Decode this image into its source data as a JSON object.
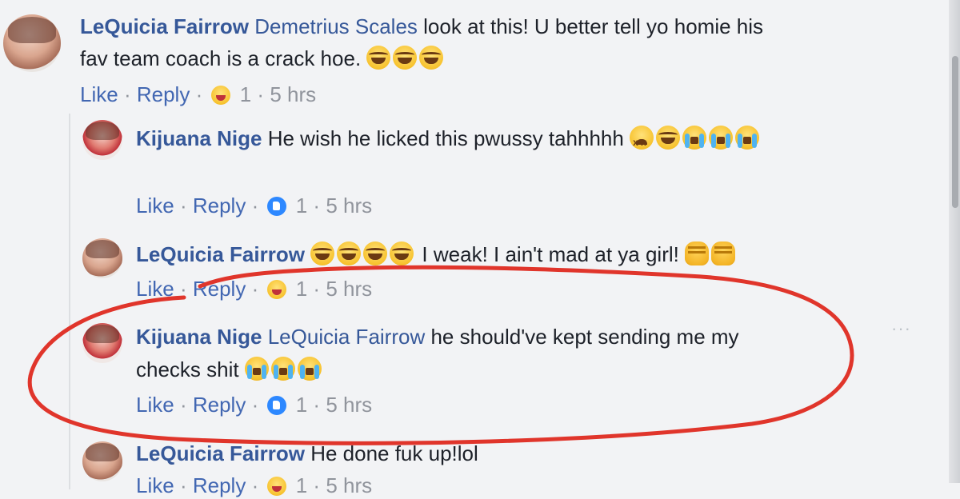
{
  "comments": [
    {
      "author": "LeQuicia Fairrow",
      "mention": "Demetrius Scales",
      "line1": "look at this! U better tell yo homie his",
      "line2": "fav team coach is a crack hoe.",
      "emojis": [
        "face-with-tears-of-joy",
        "face-with-tears-of-joy",
        "face-with-tears-of-joy"
      ],
      "actions": {
        "like": "Like",
        "reply": "Reply",
        "reaction": "haha",
        "count": "1",
        "time": "5 hrs"
      }
    },
    {
      "author": "Kijuana Nige",
      "line1": "He wish he licked this pwussy tahhhhh",
      "emojis": [
        "tired-face",
        "face-with-tears-of-joy",
        "loudly-crying-face",
        "loudly-crying-face",
        "loudly-crying-face"
      ],
      "actions": {
        "like": "Like",
        "reply": "Reply",
        "reaction": "like",
        "count": "1",
        "time": "5 hrs"
      }
    },
    {
      "author": "LeQuicia Fairrow",
      "line1": "I weak! I ain't mad at ya girl!",
      "emojis_before": [
        "face-with-tears-of-joy",
        "face-with-tears-of-joy",
        "face-with-tears-of-joy",
        "face-with-tears-of-joy"
      ],
      "emojis_after": [
        "raised-fist",
        "raised-fist"
      ],
      "actions": {
        "like": "Like",
        "reply": "Reply",
        "reaction": "haha",
        "count": "1",
        "time": "5 hrs"
      }
    },
    {
      "author": "Kijuana Nige",
      "mention": "LeQuicia Fairrow",
      "line1": "he should've kept sending me my",
      "line2": "checks shit",
      "emojis": [
        "loudly-crying-face",
        "loudly-crying-face",
        "loudly-crying-face"
      ],
      "actions": {
        "like": "Like",
        "reply": "Reply",
        "reaction": "like",
        "count": "1",
        "time": "5 hrs"
      },
      "more": "···"
    },
    {
      "author": "LeQuicia Fairrow",
      "line1": "He done fuk up!lol",
      "actions": {
        "like": "Like",
        "reply": "Reply",
        "reaction": "haha",
        "count": "1",
        "time": "5 hrs"
      }
    }
  ],
  "separator": "·",
  "colors": {
    "name": "#365899",
    "link": "#4267b2",
    "muted": "#90949c",
    "annotation": "#e0352b",
    "background": "#f2f3f5"
  }
}
